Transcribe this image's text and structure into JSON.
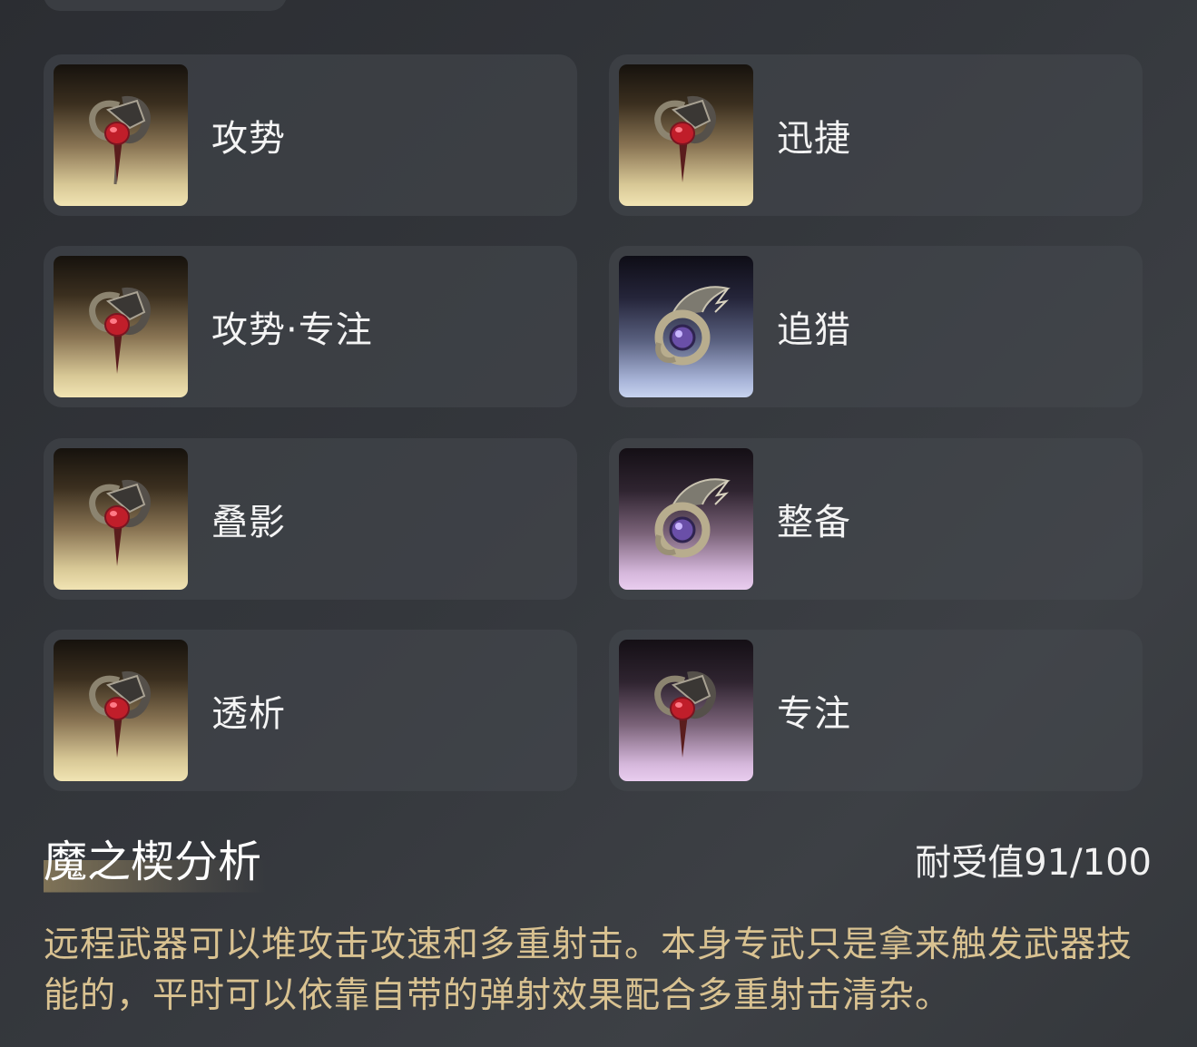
{
  "mods": [
    {
      "name": "攻势",
      "icon": "red-gem-mod-icon",
      "tint": "gold"
    },
    {
      "name": "迅捷",
      "icon": "red-gem-mod-icon",
      "tint": "gold"
    },
    {
      "name": "攻势·专注",
      "icon": "red-gem-mod-icon",
      "tint": "gold"
    },
    {
      "name": "追猎",
      "icon": "winged-purple-gem-mod-icon",
      "tint": "blue"
    },
    {
      "name": "叠影",
      "icon": "red-gem-mod-icon",
      "tint": "gold"
    },
    {
      "name": "整备",
      "icon": "winged-purple-gem-mod-icon",
      "tint": "violet"
    },
    {
      "name": "透析",
      "icon": "red-gem-mod-icon",
      "tint": "gold"
    },
    {
      "name": "专注",
      "icon": "red-gem-mod-icon",
      "tint": "violet"
    }
  ],
  "analysis": {
    "title": "魔之楔分析",
    "durability": "耐受值91/100",
    "description": "远程武器可以堆攻击攻速和多重射击。本身专武只是拿来触发武器技能的，平时可以依靠自带的弹射效果配合多重射击清杂。"
  },
  "colors": {
    "description_text": "#d9c291",
    "card_bg": "#46494f",
    "page_bg": "#34373c"
  }
}
